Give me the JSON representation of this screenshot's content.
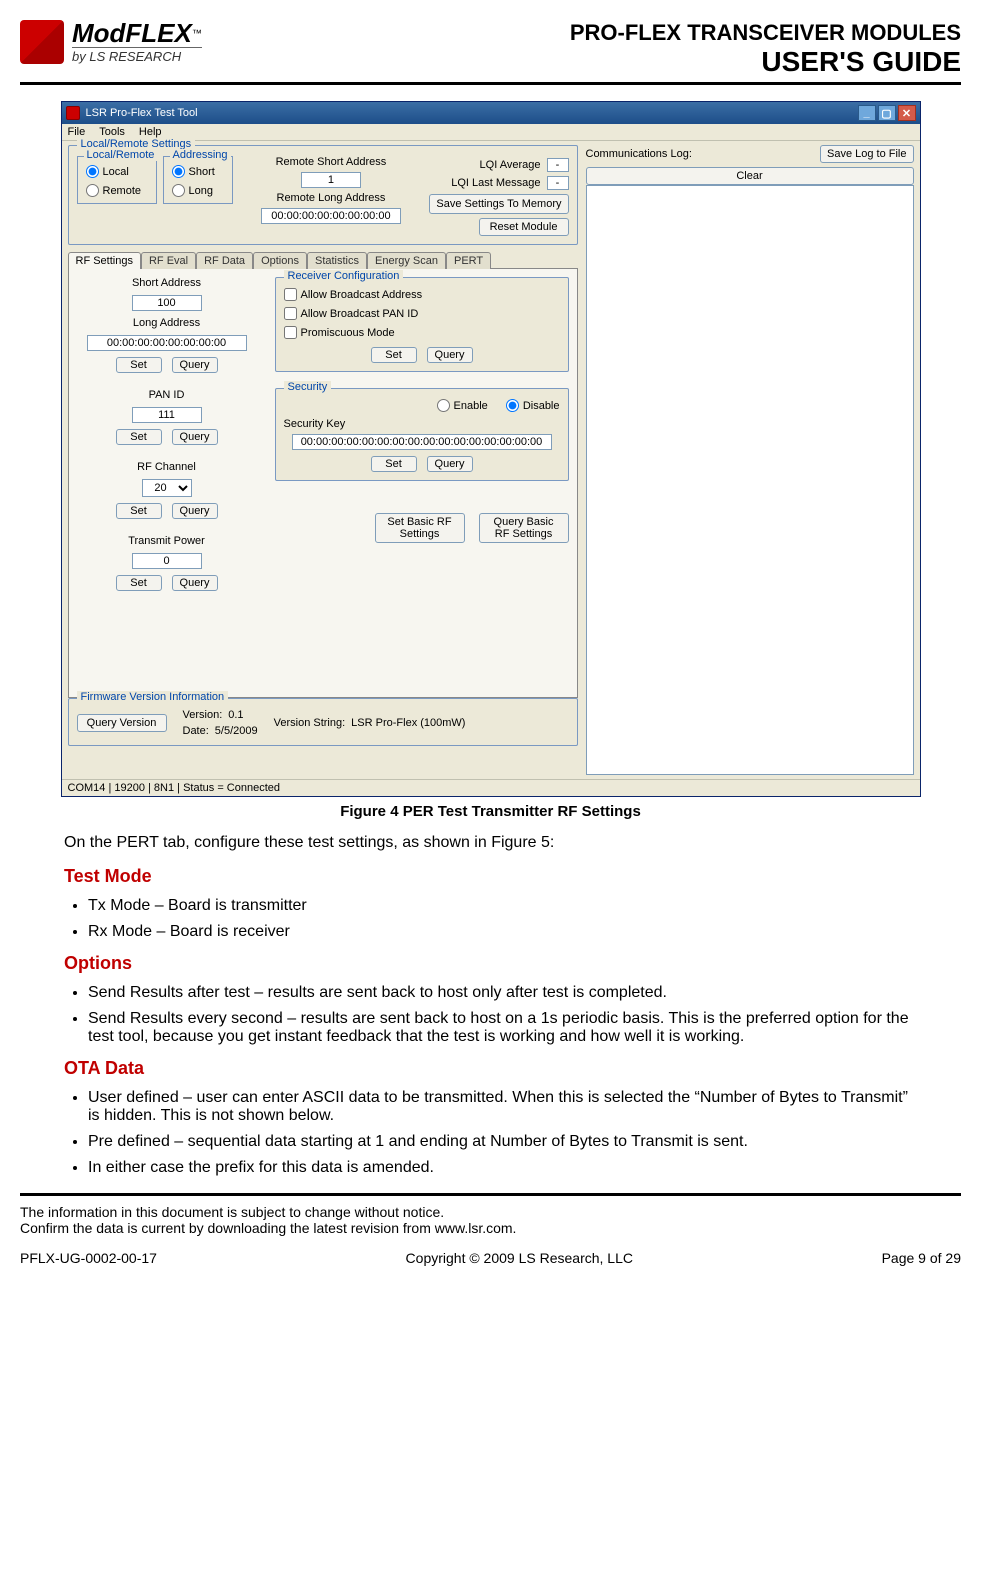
{
  "header": {
    "logo_main": "ModFLEX",
    "logo_tm": "™",
    "logo_sub": "by LS RESEARCH",
    "title_line1": "PRO-FLEX TRANSCEIVER MODULES",
    "title_line2": "USER'S GUIDE"
  },
  "app": {
    "title": "LSR Pro-Flex Test Tool",
    "menu": {
      "file": "File",
      "tools": "Tools",
      "help": "Help"
    },
    "local_remote_settings": {
      "legend": "Local/Remote Settings",
      "local_remote": {
        "legend": "Local/Remote",
        "local": "Local",
        "remote": "Remote"
      },
      "addressing": {
        "legend": "Addressing",
        "short": "Short",
        "long": "Long"
      },
      "remote_short_label": "Remote Short Address",
      "remote_short_value": "1",
      "remote_long_label": "Remote Long Address",
      "remote_long_value": "00:00:00:00:00:00:00:00",
      "lqi_avg_label": "LQI Average",
      "lqi_avg_value": "-",
      "lqi_last_label": "LQI Last Message",
      "lqi_last_value": "-",
      "save_settings": "Save Settings To Memory",
      "reset_module": "Reset Module"
    },
    "tabs": [
      "RF Settings",
      "RF Eval",
      "RF Data",
      "Options",
      "Statistics",
      "Energy Scan",
      "PERT"
    ],
    "rf": {
      "short_addr_label": "Short Address",
      "short_addr_value": "100",
      "long_addr_label": "Long Address",
      "long_addr_value": "00:00:00:00:00:00:00:00",
      "set": "Set",
      "query": "Query",
      "pan_id_label": "PAN ID",
      "pan_id_value": "111",
      "rf_channel_label": "RF Channel",
      "rf_channel_value": "20",
      "tx_power_label": "Transmit Power",
      "tx_power_value": "0",
      "recv_cfg": {
        "legend": "Receiver Configuration",
        "allow_bcast_addr": "Allow Broadcast Address",
        "allow_bcast_pan": "Allow Broadcast PAN ID",
        "promiscuous": "Promiscuous Mode"
      },
      "security": {
        "legend": "Security",
        "enable": "Enable",
        "disable": "Disable",
        "key_label": "Security Key",
        "key_value": "00:00:00:00:00:00:00:00:00:00:00:00:00:00:00:00"
      },
      "set_basic": "Set Basic RF\nSettings",
      "query_basic": "Query Basic\nRF Settings"
    },
    "fw": {
      "legend": "Firmware Version Information",
      "query_btn": "Query Version",
      "version_label": "Version:",
      "version_value": "0.1",
      "date_label": "Date:",
      "date_value": "5/5/2009",
      "vstring_label": "Version String:",
      "vstring_value": "LSR Pro-Flex (100mW)"
    },
    "comms": {
      "label": "Communications Log:",
      "save": "Save Log to File",
      "clear": "Clear"
    },
    "statusbar": "COM14 | 19200 | 8N1 | Status = Connected"
  },
  "caption": "Figure 4 PER Test Transmitter RF Settings",
  "body": {
    "intro": "On the PERT tab, configure these test settings, as shown in Figure 5:",
    "h_testmode": "Test Mode",
    "testmode_items": [
      "Tx Mode – Board is transmitter",
      "Rx Mode – Board is receiver"
    ],
    "h_options": "Options",
    "options_items": [
      "Send Results after test – results are sent back to host only after test is completed.",
      "Send Results every second – results are sent back to host on a 1s periodic basis.  This is the preferred option for the test tool, because you get instant feedback that the test is working and how well it is working."
    ],
    "h_ota": "OTA Data",
    "ota_items": [
      "User defined – user can enter ASCII data to be transmitted.  When this is selected the “Number of Bytes to Transmit” is hidden.  This is not shown below.",
      "Pre defined – sequential data starting at 1 and ending at Number of Bytes to Transmit is sent.",
      "In either case the prefix for this data is amended."
    ]
  },
  "footer": {
    "note1": "The information in this document is subject to change without notice.",
    "note2": "Confirm the data is current by downloading the latest revision from www.lsr.com.",
    "docnum": "PFLX-UG-0002-00-17",
    "copyright": "Copyright © 2009 LS Research, LLC",
    "page": "Page 9 of 29"
  }
}
